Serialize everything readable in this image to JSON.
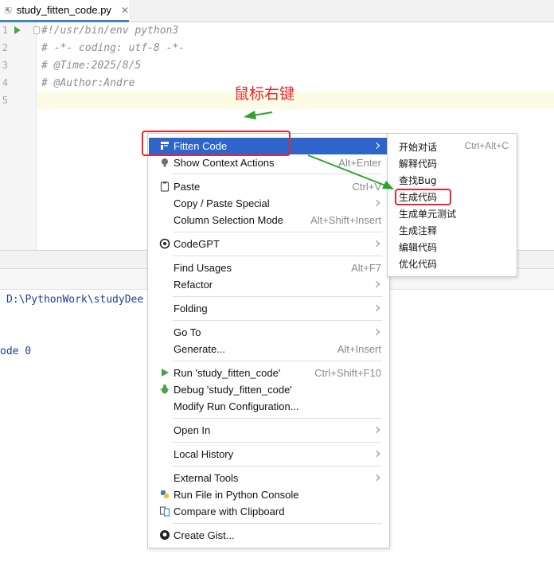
{
  "tab": {
    "filename": "study_fitten_code.py",
    "close": "✕"
  },
  "editor": {
    "line_numbers": [
      "1",
      "2",
      "3",
      "4",
      "5"
    ],
    "lines": [
      "#!/usr/bin/env python3",
      "# -*- coding: utf-8 -*-",
      "# @Time:2025/8/5",
      "# @Author:Andre",
      ""
    ]
  },
  "annotation": {
    "text": "鼠标右键",
    "color": "#e8262e"
  },
  "console": {
    "path": "D:\\PythonWork\\studyDee",
    "exit": "ode 0"
  },
  "context_menu": {
    "fitten": {
      "label": "Fitten Code"
    },
    "show_context": {
      "label": "Show Context Actions",
      "shortcut": "Alt+Enter"
    },
    "paste": {
      "label": "Paste",
      "shortcut": "Ctrl+V"
    },
    "copy_paste_special": {
      "label": "Copy / Paste Special"
    },
    "column_selection": {
      "label": "Column Selection Mode",
      "shortcut": "Alt+Shift+Insert"
    },
    "codegpt": {
      "label": "CodeGPT"
    },
    "find_usages": {
      "label": "Find Usages",
      "shortcut": "Alt+F7"
    },
    "refactor": {
      "label": "Refactor"
    },
    "folding": {
      "label": "Folding"
    },
    "go_to": {
      "label": "Go To"
    },
    "generate": {
      "label": "Generate...",
      "shortcut": "Alt+Insert"
    },
    "run": {
      "label": "Run 'study_fitten_code'",
      "shortcut": "Ctrl+Shift+F10"
    },
    "debug": {
      "label": "Debug 'study_fitten_code'"
    },
    "modify_run": {
      "label": "Modify Run Configuration..."
    },
    "open_in": {
      "label": "Open In"
    },
    "local_history": {
      "label": "Local History"
    },
    "external_tools": {
      "label": "External Tools"
    },
    "run_file_console": {
      "label": "Run File in Python Console"
    },
    "compare_clipboard": {
      "label": "Compare with Clipboard"
    },
    "create_gist": {
      "label": "Create Gist..."
    }
  },
  "submenu": {
    "start_chat": {
      "label": "开始对话",
      "shortcut": "Ctrl+Alt+C"
    },
    "explain": {
      "label": "解释代码"
    },
    "find_bug": {
      "label": "查找Bug"
    },
    "generate_code": {
      "label": "生成代码"
    },
    "generate_tests": {
      "label": "生成单元测试"
    },
    "generate_comments": {
      "label": "生成注释"
    },
    "edit_code": {
      "label": "编辑代码"
    },
    "optimize_code": {
      "label": "优化代码"
    }
  },
  "colors": {
    "selection": "#2f65ca",
    "highlight": "#e8262e",
    "arrow": "#2aa52a"
  }
}
